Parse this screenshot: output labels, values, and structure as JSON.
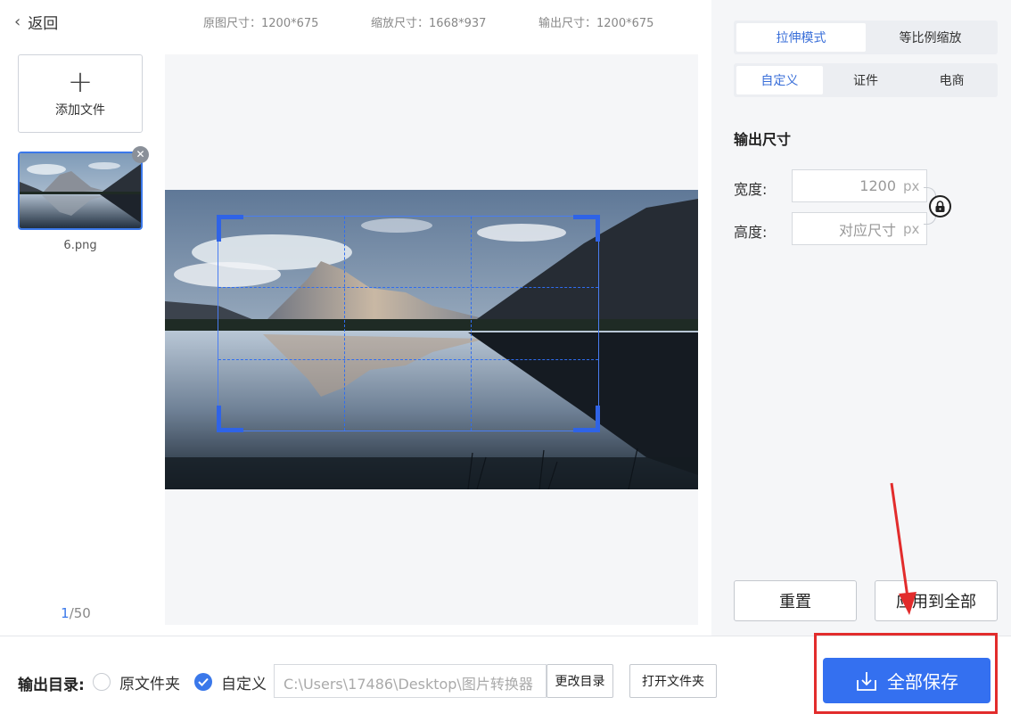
{
  "header": {
    "back_label": "返回",
    "original_size": "原图尺寸：1200*675",
    "scaled_size": "缩放尺寸：1668*937",
    "output_size": "输出尺寸：1200*675"
  },
  "files": {
    "add_label": "添加文件",
    "items": [
      {
        "name": "6.png"
      }
    ],
    "close_glyph": "✕",
    "pager": {
      "current": "1",
      "total": "/50"
    }
  },
  "panel": {
    "mode_tabs": [
      "拉伸模式",
      "等比例缩放"
    ],
    "active_mode": 0,
    "preset_tabs": [
      "自定义",
      "证件",
      "电商"
    ],
    "active_preset": 0,
    "section_title": "输出尺寸",
    "width": {
      "label": "宽度:",
      "placeholder": "1200",
      "unit": "px"
    },
    "height": {
      "label": "高度:",
      "placeholder": "对应尺寸",
      "unit": "px"
    },
    "reset_label": "重置",
    "apply_all_label": "应用到全部"
  },
  "footer": {
    "output_dir_label": "输出目录:",
    "option_original": "原文件夹",
    "option_custom": "自定义",
    "selected_option": "custom",
    "path": "C:\\Users\\17486\\Desktop\\图片转换器",
    "change_dir_label": "更改目录",
    "open_folder_label": "打开文件夹",
    "save_all_label": "全部保存"
  },
  "colors": {
    "accent": "#3470f0",
    "highlight": "#e22c2c"
  },
  "icons": {
    "back": "chevron-left-icon",
    "add": "plus-icon",
    "lock": "lock-icon",
    "save": "download-icon",
    "check": "check-icon"
  }
}
